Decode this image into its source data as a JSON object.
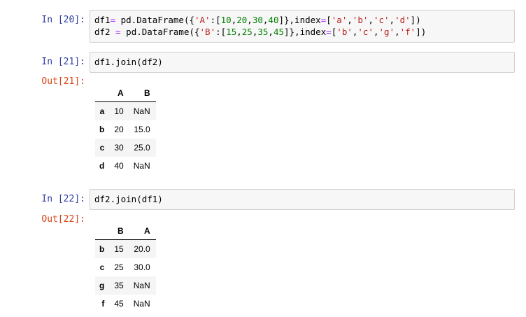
{
  "cells": [
    {
      "in_prompt": "In [20]:",
      "code_lines": [
        [
          {
            "t": "df1",
            "c": ""
          },
          {
            "t": "=",
            "c": "o"
          },
          {
            "t": " pd.DataFrame({",
            "c": ""
          },
          {
            "t": "'A'",
            "c": "s"
          },
          {
            "t": ":[",
            "c": ""
          },
          {
            "t": "10",
            "c": "n"
          },
          {
            "t": ",",
            "c": ""
          },
          {
            "t": "20",
            "c": "n"
          },
          {
            "t": ",",
            "c": ""
          },
          {
            "t": "30",
            "c": "n"
          },
          {
            "t": ",",
            "c": ""
          },
          {
            "t": "40",
            "c": "n"
          },
          {
            "t": "]},index",
            "c": ""
          },
          {
            "t": "=",
            "c": "o"
          },
          {
            "t": "[",
            "c": ""
          },
          {
            "t": "'a'",
            "c": "s"
          },
          {
            "t": ",",
            "c": ""
          },
          {
            "t": "'b'",
            "c": "s"
          },
          {
            "t": ",",
            "c": ""
          },
          {
            "t": "'c'",
            "c": "s"
          },
          {
            "t": ",",
            "c": ""
          },
          {
            "t": "'d'",
            "c": "s"
          },
          {
            "t": "])",
            "c": ""
          }
        ],
        [
          {
            "t": "df2 ",
            "c": ""
          },
          {
            "t": "=",
            "c": "o"
          },
          {
            "t": " pd.DataFrame({",
            "c": ""
          },
          {
            "t": "'B'",
            "c": "s"
          },
          {
            "t": ":[",
            "c": ""
          },
          {
            "t": "15",
            "c": "n"
          },
          {
            "t": ",",
            "c": ""
          },
          {
            "t": "25",
            "c": "n"
          },
          {
            "t": ",",
            "c": ""
          },
          {
            "t": "35",
            "c": "n"
          },
          {
            "t": ",",
            "c": ""
          },
          {
            "t": "45",
            "c": "n"
          },
          {
            "t": "]},index",
            "c": ""
          },
          {
            "t": "=",
            "c": "o"
          },
          {
            "t": "[",
            "c": ""
          },
          {
            "t": "'b'",
            "c": "s"
          },
          {
            "t": ",",
            "c": ""
          },
          {
            "t": "'c'",
            "c": "s"
          },
          {
            "t": ",",
            "c": ""
          },
          {
            "t": "'g'",
            "c": "s"
          },
          {
            "t": ",",
            "c": ""
          },
          {
            "t": "'f'",
            "c": "s"
          },
          {
            "t": "])",
            "c": ""
          }
        ]
      ]
    },
    {
      "in_prompt": "In [21]:",
      "code_lines": [
        [
          {
            "t": "df1.join(df2)",
            "c": ""
          }
        ]
      ],
      "out_prompt": "Out[21]:",
      "table": {
        "columns": [
          "A",
          "B"
        ],
        "rows": [
          {
            "index": "a",
            "values": [
              "10",
              "NaN"
            ]
          },
          {
            "index": "b",
            "values": [
              "20",
              "15.0"
            ]
          },
          {
            "index": "c",
            "values": [
              "30",
              "25.0"
            ]
          },
          {
            "index": "d",
            "values": [
              "40",
              "NaN"
            ]
          }
        ]
      }
    },
    {
      "in_prompt": "In [22]:",
      "code_lines": [
        [
          {
            "t": "df2.join(df1)",
            "c": ""
          }
        ]
      ],
      "out_prompt": "Out[22]:",
      "table": {
        "columns": [
          "B",
          "A"
        ],
        "rows": [
          {
            "index": "b",
            "values": [
              "15",
              "20.0"
            ]
          },
          {
            "index": "c",
            "values": [
              "25",
              "30.0"
            ]
          },
          {
            "index": "g",
            "values": [
              "35",
              "NaN"
            ]
          },
          {
            "index": "f",
            "values": [
              "45",
              "NaN"
            ]
          }
        ]
      }
    }
  ],
  "colors": {
    "in_prompt": "#303F9F",
    "out_prompt": "#D84315",
    "string": "#BA2121",
    "number": "#008000",
    "operator": "#AA22FF",
    "input_bg": "#f7f7f7",
    "input_border": "#cfcfcf"
  }
}
